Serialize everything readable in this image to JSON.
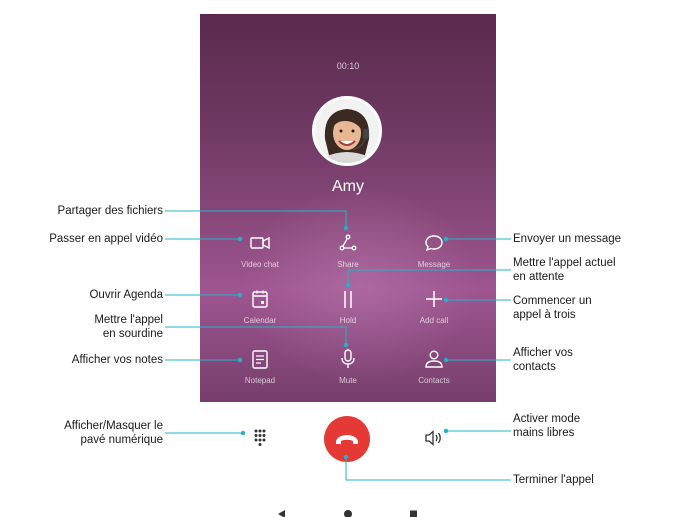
{
  "call": {
    "timer": "00:10",
    "contact_name": "Amy"
  },
  "buttons": {
    "video_chat": "Video chat",
    "share": "Share",
    "message": "Message",
    "calendar": "Calendar",
    "hold": "Hold",
    "add_call": "Add call",
    "notepad": "Notepad",
    "mute": "Mute",
    "contacts": "Contacts"
  },
  "callouts": {
    "share": "Partager des fichiers",
    "video": "Passer en appel vidéo",
    "message": "Envoyer un message",
    "hold_1": "Mettre l'appel actuel",
    "hold_2": "en attente",
    "add_call_1": "Commencer un",
    "add_call_2": "appel à trois",
    "calendar": "Ouvrir Agenda",
    "mute_1": "Mettre l'appel",
    "mute_2": "en sourdine",
    "notepad": "Afficher vos notes",
    "contacts_1": "Afficher vos",
    "contacts_2": "contacts",
    "dialpad_1": "Afficher/Masquer le",
    "dialpad_2": "pavé numérique",
    "speaker_1": "Activer mode",
    "speaker_2": "mains libres",
    "end_call": "Terminer l'appel"
  },
  "icons": {
    "video": "video-camera-icon",
    "share": "share-icon",
    "message": "speech-bubble-icon",
    "calendar": "calendar-icon",
    "hold": "pause-icon",
    "add_call": "plus-icon",
    "notepad": "notepad-icon",
    "mute": "microphone-icon",
    "contacts": "person-icon",
    "dialpad": "dialpad-icon",
    "end_call": "phone-hangup-icon",
    "speaker": "speaker-icon",
    "nav_back": "triangle-back-icon",
    "nav_home": "circle-home-icon",
    "nav_recent": "square-recent-icon"
  },
  "colors": {
    "end_call": "#e53935",
    "callout_line": "#1fb5c9",
    "background_top": "#5a2a4c",
    "background_mid": "#9e5590"
  }
}
